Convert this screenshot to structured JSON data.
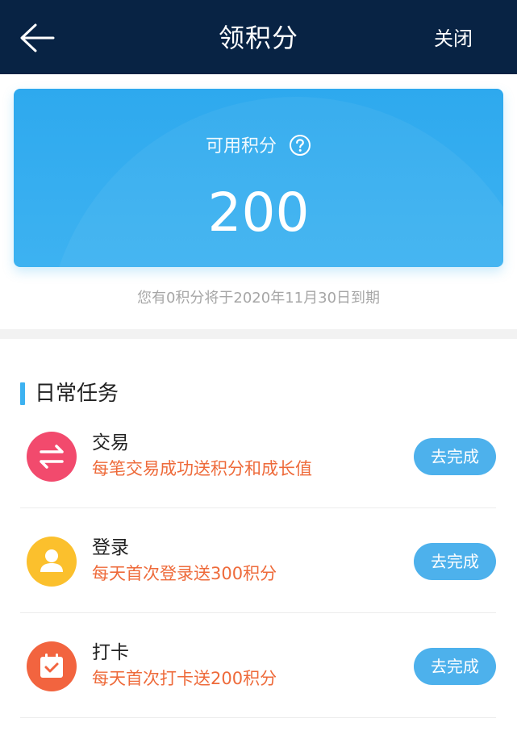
{
  "header": {
    "title": "领积分",
    "close_label": "关闭"
  },
  "points_card": {
    "label": "可用积分",
    "value": "200"
  },
  "expiry_note": "您有0积分将于2020年11月30日到期",
  "daily_tasks": {
    "title": "日常任务",
    "items": [
      {
        "name": "交易",
        "desc": "每笔交易成功送积分和成长值",
        "button": "去完成",
        "icon": "exchange-icon",
        "color": "#f24a6d"
      },
      {
        "name": "登录",
        "desc": "每天首次登录送300积分",
        "button": "去完成",
        "icon": "user-icon",
        "color": "#fbc02d"
      },
      {
        "name": "打卡",
        "desc": "每天首次打卡送200积分",
        "button": "去完成",
        "icon": "calendar-check-icon",
        "color": "#f2643f"
      }
    ]
  },
  "colors": {
    "header_bg": "#082344",
    "card_blue": "#3db2f1",
    "accent_orange": "#ee6a3a",
    "button_blue": "#4db1ec"
  }
}
